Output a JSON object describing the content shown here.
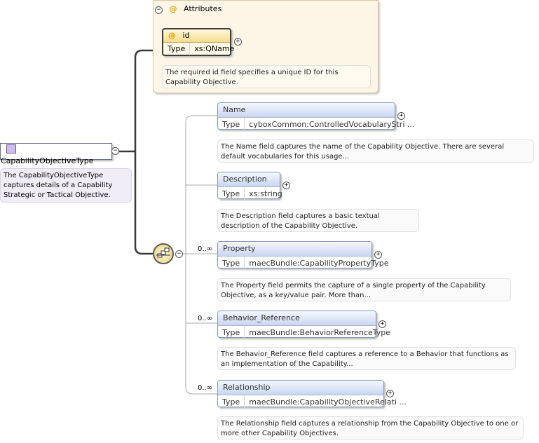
{
  "root": {
    "name": "CapabilityObjectiveType",
    "description": "The CapabilityObjectiveType captures details of a Capability Strategic or Tactical Objective."
  },
  "attributes": {
    "group_label": "Attributes",
    "id": {
      "name": "id",
      "type_label": "Type",
      "type_value": "xs:QName",
      "description": "The required id field specifies a unique ID for this Capability Objective."
    }
  },
  "elements": [
    {
      "name": "Name",
      "cardinality": "",
      "type_label": "Type",
      "type_value": "cyboxCommon:ControlledVocabularyStri ...",
      "description": "The Name field captures the name of the Capability Objective. There are several default vocabularies for this usage..."
    },
    {
      "name": "Description",
      "cardinality": "",
      "type_label": "Type",
      "type_value": "xs:string",
      "description": "The Description field captures a basic textual description of the Capability Objective."
    },
    {
      "name": "Property",
      "cardinality": "0..∞",
      "type_label": "Type",
      "type_value": "maecBundle:CapabilityPropertyType",
      "description": "The Property field permits the capture of a single property of the Capability Objective, as a key/value pair. More than..."
    },
    {
      "name": "Behavior_Reference",
      "cardinality": "0..∞",
      "type_label": "Type",
      "type_value": "maecBundle:BehaviorReferenceType",
      "description": "The Behavior_Reference field captures a reference to a Behavior that functions as an implementation of the Capability..."
    },
    {
      "name": "Relationship",
      "cardinality": "0..∞",
      "type_label": "Type",
      "type_value": "maecBundle:CapabilityObjectiveRelati ...",
      "description": "The Relationship field captures a relationship from the Capability Objective to one or more other Capability Objectives."
    }
  ],
  "icons": {
    "collapse": "−",
    "expand": "+",
    "attribute": "@"
  }
}
